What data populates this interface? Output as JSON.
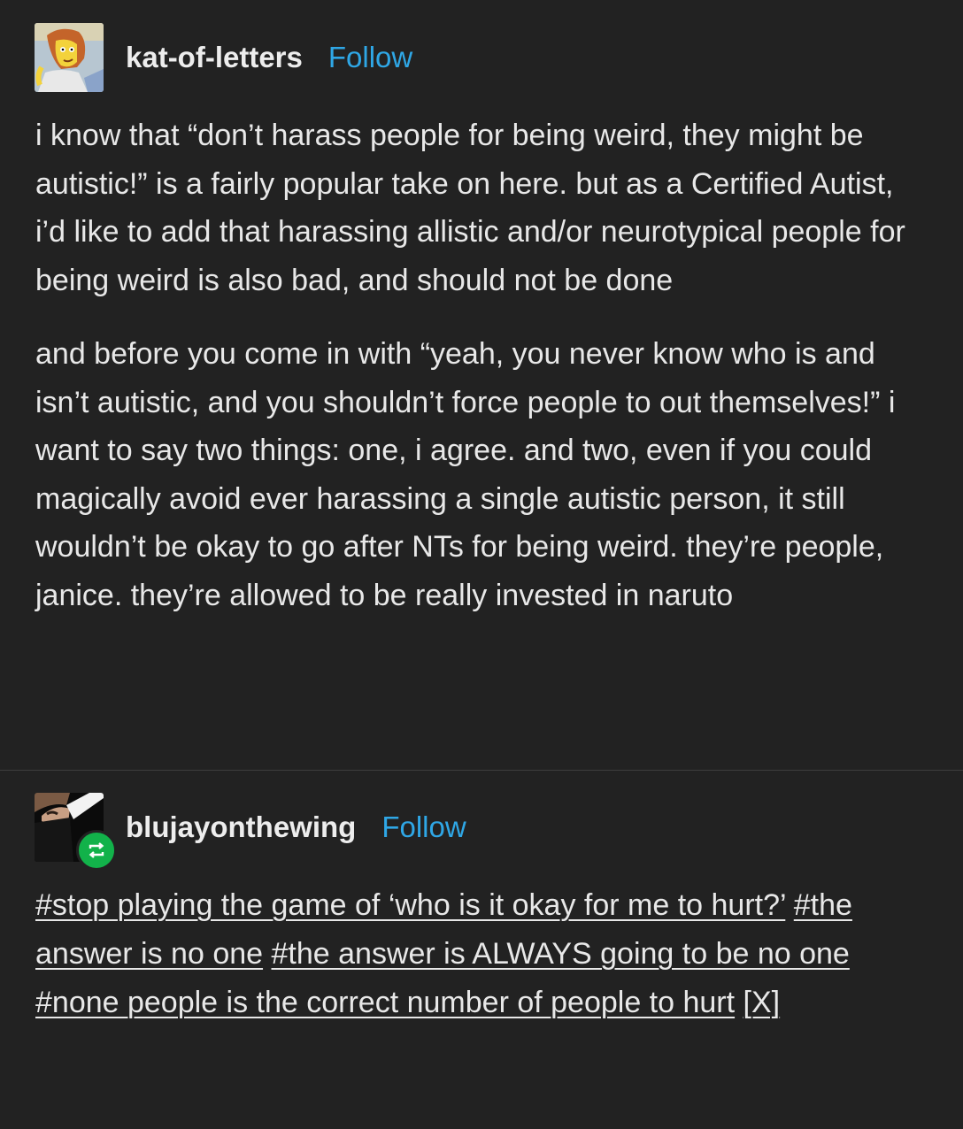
{
  "post1": {
    "username": "kat-of-letters",
    "follow_label": "Follow",
    "paragraphs": [
      "i know that “don’t harass people for being weird, they might be autistic!” is a fairly popular take on here. but as a Certified Autist, i’d like to add that harassing allistic and/or neurotypical people for being weird is also bad, and should not be done",
      "and before you come in with “yeah, you never know who is and isn’t autistic, and you shouldn’t force people to out themselves!” i want to say two things: one, i agree. and two, even if you could magically avoid ever harassing a single autistic person, it still wouldn’t be okay to go after NTs for being weird. they’re people, janice. they’re allowed to be really invested in naruto"
    ]
  },
  "post2": {
    "username": "blujayonthewing",
    "follow_label": "Follow",
    "tags": [
      "#stop playing the game of ‘who is it okay for me to hurt?’",
      "#the answer is no one",
      "#the answer is ALWAYS going to be no one",
      "#none people is the correct number of people to hurt"
    ],
    "source_label": "[X]"
  },
  "icons": {
    "avatar1": "cartoon-woman-avatar",
    "avatar2": "photo-avatar",
    "reblog": "reblog-icon"
  },
  "colors": {
    "background": "#222222",
    "follow": "#2fa7e6",
    "reblog_badge": "#12b24a"
  }
}
